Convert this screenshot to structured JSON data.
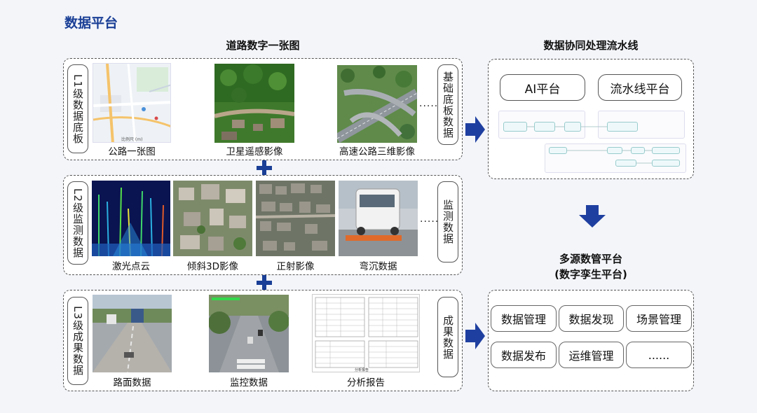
{
  "page_title": "数据平台",
  "left": {
    "title": "道路数字一张图",
    "rows": [
      {
        "label": "L1级数据底板",
        "right_label": "基础底板数据",
        "images": [
          {
            "caption": "公路一张图",
            "icon": "map-image",
            "scale_text": "比例尺 (m)"
          },
          {
            "caption": "卫星遥感影像",
            "icon": "satellite-image"
          },
          {
            "caption": "高速公路三维影像",
            "icon": "highway-3d-image"
          }
        ],
        "ellipsis": "......"
      },
      {
        "label": "L2级监测数据",
        "right_label": "监测数据",
        "images": [
          {
            "caption": "激光点云",
            "icon": "point-cloud-image"
          },
          {
            "caption": "倾斜3D影像",
            "icon": "oblique-3d-image"
          },
          {
            "caption": "正射影像",
            "icon": "orthophoto-image"
          },
          {
            "caption": "弯沉数据",
            "icon": "deflection-vehicle-image"
          }
        ],
        "ellipsis": "......"
      },
      {
        "label": "L3级成果数据",
        "right_label": "成果数据",
        "images": [
          {
            "caption": "路面数据",
            "icon": "road-surface-image"
          },
          {
            "caption": "监控数据",
            "icon": "surveillance-image"
          },
          {
            "caption": "分析报告",
            "icon": "report-document-image",
            "doc_note": "分析报告"
          }
        ],
        "ellipsis": ""
      }
    ]
  },
  "right": {
    "pipeline_title": "数据协同处理流水线",
    "pipeline_buttons": [
      "AI平台",
      "流水线平台"
    ],
    "platform_title": "多源数管平台",
    "platform_subtitle": "(数字孪生平台)",
    "platform_items": [
      "数据管理",
      "数据发现",
      "场景管理",
      "数据发布",
      "运维管理",
      "......"
    ]
  },
  "colors": {
    "accent": "#1a3f96",
    "arrow": "#1f3fa0",
    "border": "#555555"
  }
}
